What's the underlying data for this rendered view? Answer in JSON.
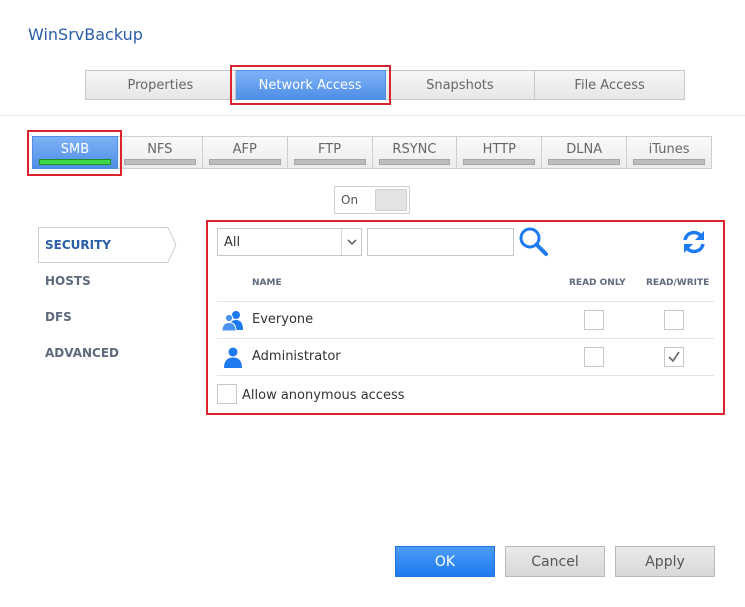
{
  "app": {
    "title": "WinSrvBackup"
  },
  "main_tabs": [
    {
      "label": "Properties",
      "active": false
    },
    {
      "label": "Network Access",
      "active": true
    },
    {
      "label": "Snapshots",
      "active": false
    },
    {
      "label": "File Access",
      "active": false
    }
  ],
  "protocol_tabs": [
    {
      "label": "SMB",
      "active": true
    },
    {
      "label": "NFS",
      "active": false
    },
    {
      "label": "AFP",
      "active": false
    },
    {
      "label": "FTP",
      "active": false
    },
    {
      "label": "RSYNC",
      "active": false
    },
    {
      "label": "HTTP",
      "active": false
    },
    {
      "label": "DLNA",
      "active": false
    },
    {
      "label": "iTunes",
      "active": false
    }
  ],
  "toggle": {
    "label": "On"
  },
  "sidebar": {
    "items": [
      {
        "label": "SECURITY",
        "active": true
      },
      {
        "label": "HOSTS",
        "active": false
      },
      {
        "label": "DFS",
        "active": false
      },
      {
        "label": "ADVANCED",
        "active": false
      }
    ]
  },
  "filter": {
    "selected": "All"
  },
  "search": {
    "value": "",
    "placeholder": ""
  },
  "table": {
    "columns": {
      "name": "NAME",
      "read_only": "READ ONLY",
      "read_write": "READ/WRITE"
    },
    "rows": [
      {
        "name": "Everyone",
        "icon": "group-icon",
        "read_only": false,
        "read_write": false
      },
      {
        "name": "Administrator",
        "icon": "user-icon",
        "read_only": false,
        "read_write": true
      }
    ]
  },
  "anonymous": {
    "label": "Allow anonymous access",
    "checked": false
  },
  "buttons": {
    "ok": "OK",
    "cancel": "Cancel",
    "apply": "Apply"
  },
  "colors": {
    "accent": "#4f8fe6",
    "highlight": "#d9232e",
    "active_bar": "#3ed94b",
    "title": "#2a5ea8"
  }
}
